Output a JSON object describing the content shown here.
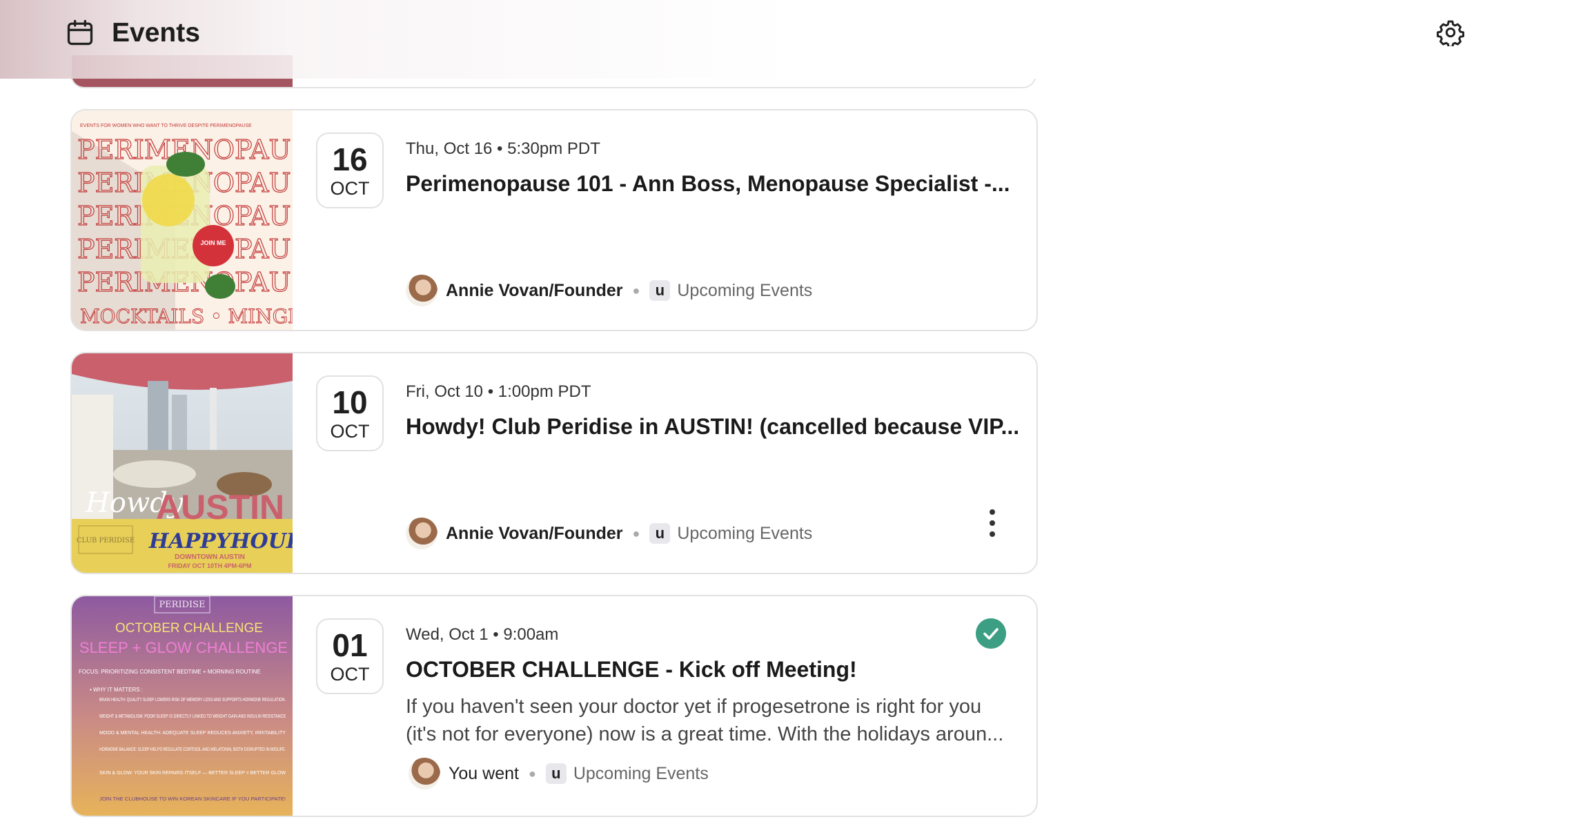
{
  "header": {
    "title": "Events",
    "calendar_icon": "calendar-icon",
    "settings_icon": "gear-icon"
  },
  "colors": {
    "success": "#3c9f83",
    "peek_image": "#a5555f"
  },
  "events": [
    {
      "day": "16",
      "month": "OCT",
      "when": "Thu, Oct 16 • 5:30pm PDT",
      "title": "Perimenopause 101 - Ann Boss, Menopause Specialist -...",
      "author": "Annie Vovan/Founder",
      "space_badge": "u",
      "space": "Upcoming Events",
      "thumb": {
        "top_line": "EVENTS FOR WOMEN WHO WANT TO THRIVE DESPITE PERIMENOPAUSE",
        "repeat_word": "PERIMENOPAUSE",
        "badge": "JOIN ME",
        "bottom": "MOCKTAILS • MINGLE"
      }
    },
    {
      "day": "10",
      "month": "OCT",
      "when": "Fri, Oct 10 • 1:00pm PDT",
      "title": "Howdy! Club Peridise in AUSTIN! (cancelled because VIP...",
      "author": "Annie Vovan/Founder",
      "space_badge": "u",
      "space": "Upcoming Events",
      "thumb": {
        "script": "Howdy",
        "city": "AUSTIN",
        "logo": "CLUB PERIDISE",
        "happy": "HAPPYHOUR",
        "line1": "DOWNTOWN AUSTIN",
        "line2": "FRIDAY OCT 10TH 4PM-6PM"
      }
    },
    {
      "day": "01",
      "month": "OCT",
      "when": "Wed, Oct 1 • 9:00am",
      "title": "OCTOBER CHALLENGE - Kick off Meeting!",
      "description": "If you haven't seen your doctor yet if progesetrone is right for you (it's not for everyone) now is a great time.  With the holidays aroun...",
      "author": "You went",
      "space_badge": "u",
      "space": "Upcoming Events",
      "thumb": {
        "logo": "PERIDISE",
        "head1": "OCTOBER CHALLENGE",
        "head2": "SLEEP + GLOW CHALLENGE",
        "focus": "FOCUS: PRIORITIZING CONSISTENT BEDTIME + MORNING ROUTINE",
        "why": "• WHY IT MATTERS :",
        "bullets": [
          "BRAIN HEALTH: QUALITY SLEEP LOWERS RISK OF MEMORY LOSS AND SUPPORTS HORMONE REGULATION.",
          "WEIGHT & METABOLISM: POOR SLEEP IS DIRECTLY LINKED TO WEIGHT GAIN AND INSULIN RESISTANCE",
          "MOOD & MENTAL HEALTH: ADEQUATE SLEEP REDUCES ANXIETY, IRRITABILITY",
          "HORMONE BALANCE: SLEEP HELPS REGULATE CORTISOL AND MELATONIN, BOTH DISRUPTED IN MIDLIFE.",
          "SKIN & GLOW: YOUR SKIN REPAIRS ITSELF — BETTER SLEEP = BETTER GLOW"
        ],
        "footer": "JOIN THE CLUBHOUSE TO WIN KOREAN SKINCARE IF YOU PARTICIPATE!"
      }
    }
  ]
}
